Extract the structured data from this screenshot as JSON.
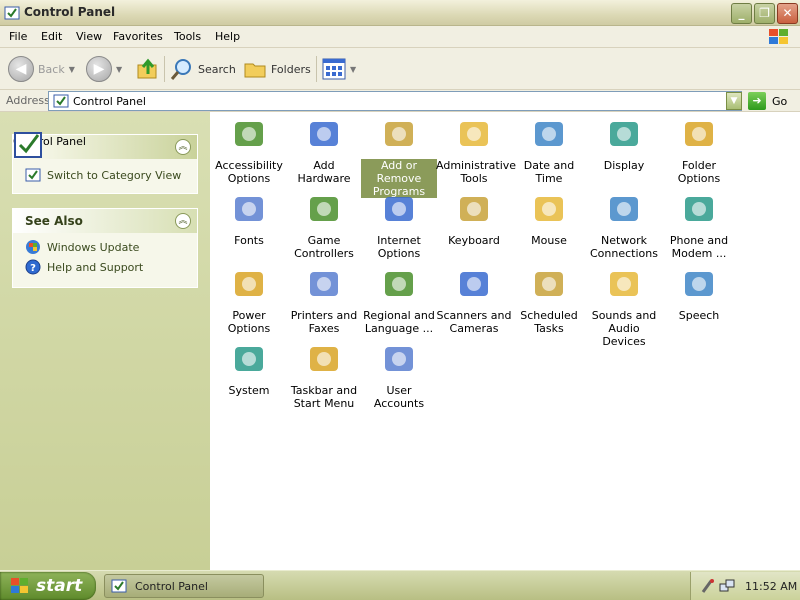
{
  "window": {
    "title": "Control Panel"
  },
  "menubar": {
    "items": [
      "File",
      "Edit",
      "View",
      "Favorites",
      "Tools",
      "Help"
    ]
  },
  "toolbar": {
    "back_label": "Back",
    "search_label": "Search",
    "folders_label": "Folders"
  },
  "address": {
    "label": "Address",
    "value": "Control Panel",
    "go_label": "Go"
  },
  "sidebar": {
    "control_panel": {
      "title": "Control Panel",
      "link": "Switch to Category View"
    },
    "see_also": {
      "title": "See Also",
      "links": [
        "Windows Update",
        "Help and Support"
      ]
    }
  },
  "items": [
    {
      "label": "Accessibility Options",
      "icon": "accessibility-icon"
    },
    {
      "label": "Add Hardware",
      "icon": "add-hardware-icon"
    },
    {
      "label": "Add or Remove Programs",
      "icon": "add-remove-programs-icon"
    },
    {
      "label": "Administrative Tools",
      "icon": "administrative-tools-icon"
    },
    {
      "label": "Date and Time",
      "icon": "date-time-icon"
    },
    {
      "label": "Display",
      "icon": "display-icon"
    },
    {
      "label": "Folder Options",
      "icon": "folder-options-icon"
    },
    {
      "label": "Fonts",
      "icon": "fonts-icon"
    },
    {
      "label": "Game Controllers",
      "icon": "game-controllers-icon"
    },
    {
      "label": "Internet Options",
      "icon": "internet-options-icon"
    },
    {
      "label": "Keyboard",
      "icon": "keyboard-icon"
    },
    {
      "label": "Mouse",
      "icon": "mouse-icon"
    },
    {
      "label": "Network Connections",
      "icon": "network-connections-icon"
    },
    {
      "label": "Phone and Modem ...",
      "icon": "phone-modem-icon"
    },
    {
      "label": "Power Options",
      "icon": "power-options-icon"
    },
    {
      "label": "Printers and Faxes",
      "icon": "printers-faxes-icon"
    },
    {
      "label": "Regional and Language ...",
      "icon": "regional-language-icon"
    },
    {
      "label": "Scanners and Cameras",
      "icon": "scanners-cameras-icon"
    },
    {
      "label": "Scheduled Tasks",
      "icon": "scheduled-tasks-icon"
    },
    {
      "label": "Sounds and Audio Devices",
      "icon": "sounds-audio-icon"
    },
    {
      "label": "Speech",
      "icon": "speech-icon"
    },
    {
      "label": "System",
      "icon": "system-icon"
    },
    {
      "label": "Taskbar and Start Menu",
      "icon": "taskbar-start-menu-icon"
    },
    {
      "label": "User Accounts",
      "icon": "user-accounts-icon"
    }
  ],
  "selected_item": "Add or Remove Programs",
  "taskbar": {
    "start_label": "start",
    "task_label": "Control Panel",
    "clock": "11:52 AM"
  },
  "colors": {
    "selection": "#8b9b5a",
    "sidebar_bg": "#d9dfb3",
    "start_green": "#5e8a2b"
  }
}
